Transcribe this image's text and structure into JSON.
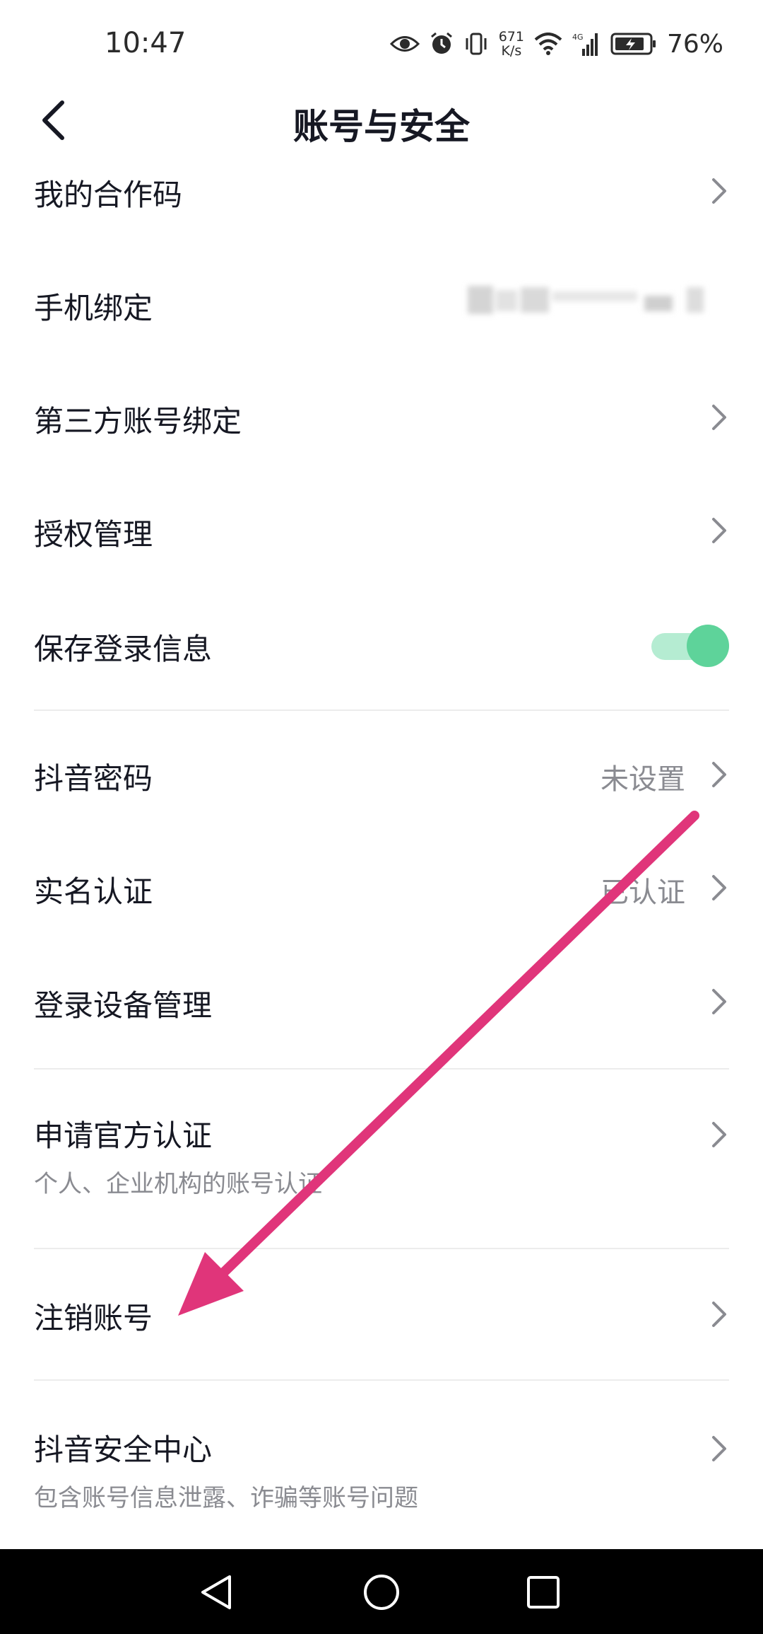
{
  "status_bar": {
    "time": "10:47",
    "net_speed_value": "671",
    "net_speed_unit": "K/s",
    "network_type": "4G",
    "battery_percent": "76%"
  },
  "header": {
    "title": "账号与安全",
    "back_icon": "chevron-left-icon"
  },
  "rows": {
    "partner_code": {
      "label": "我的合作码"
    },
    "phone_binding": {
      "label": "手机绑定",
      "value_masked": true
    },
    "third_party": {
      "label": "第三方账号绑定"
    },
    "authorization": {
      "label": "授权管理"
    },
    "save_login": {
      "label": "保存登录信息",
      "toggle_on": true
    },
    "douyin_password": {
      "label": "抖音密码",
      "value": "未设置"
    },
    "real_name": {
      "label": "实名认证",
      "value": "已认证"
    },
    "device_manage": {
      "label": "登录设备管理"
    },
    "official_cert": {
      "label": "申请官方认证",
      "sub": "个人、企业机构的账号认证"
    },
    "cancel_account": {
      "label": "注销账号"
    },
    "security_center": {
      "label": "抖音安全中心",
      "sub": "包含账号信息泄露、诈骗等账号问题"
    }
  },
  "system_nav": {
    "back": "triangle-back-icon",
    "home": "circle-home-icon",
    "recents": "square-recents-icon"
  },
  "colors": {
    "toggle_track": "#b5ecd2",
    "toggle_knob": "#5ed39a",
    "annotation_arrow": "#e0357a",
    "text_primary": "#161823",
    "text_secondary": "#8a8b91"
  }
}
